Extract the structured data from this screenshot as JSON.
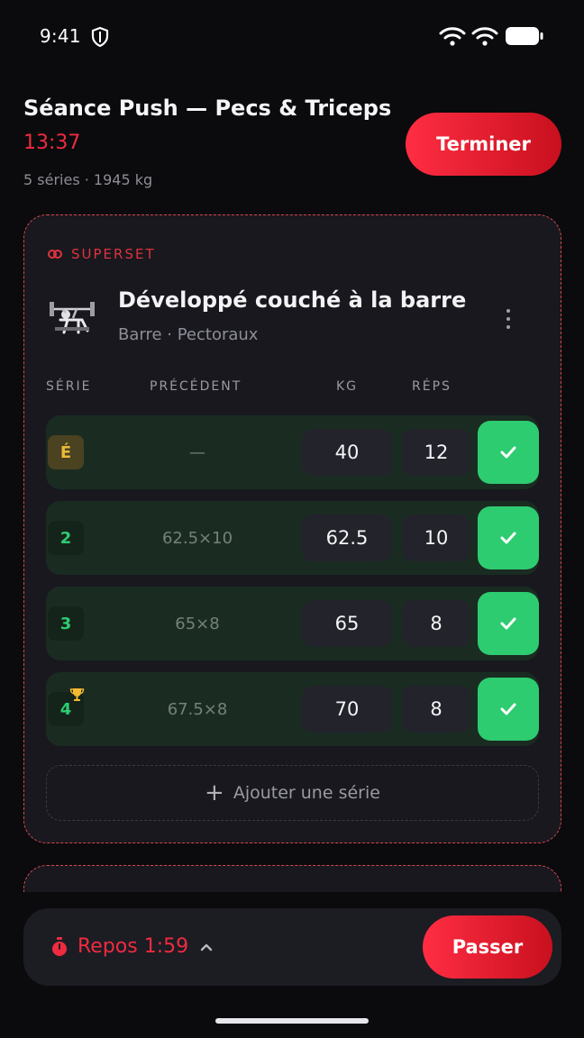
{
  "status_bar": {
    "time": "9:41",
    "icons": [
      "shield-icon",
      "wifi-icon",
      "wifi-icon",
      "battery-icon"
    ]
  },
  "header": {
    "title": "Séance Push — Pecs & Triceps",
    "timer": "13:37",
    "summary": "5 séries · 1945 kg",
    "finish_label": "Terminer"
  },
  "exercise": {
    "group_label": "SUPERSET",
    "name": "Développé couché à la barre",
    "meta": "Barre · Pectoraux",
    "columns": {
      "set": "SÉRIE",
      "previous": "PRÉCÉDENT",
      "kg": "KG",
      "reps": "RÉPS"
    },
    "sets": [
      {
        "label": "É",
        "previous": "—",
        "kg": "40",
        "reps": "12",
        "type": "warmup",
        "pr": false,
        "done": true
      },
      {
        "label": "2",
        "previous": "62.5×10",
        "kg": "62.5",
        "reps": "10",
        "type": "normal",
        "pr": false,
        "done": true
      },
      {
        "label": "3",
        "previous": "65×8",
        "kg": "65",
        "reps": "8",
        "type": "normal",
        "pr": false,
        "done": true
      },
      {
        "label": "4",
        "previous": "67.5×8",
        "kg": "70",
        "reps": "8",
        "type": "normal",
        "pr": true,
        "done": true
      }
    ],
    "add_set_label": "Ajouter une série"
  },
  "rest": {
    "label": "Repos 1:59",
    "skip_label": "Passer"
  },
  "colors": {
    "accent": "#ef2b3f",
    "success": "#2ecc71",
    "warmup": "#e8b93a",
    "background": "#0b0b0d",
    "card": "#18181e"
  }
}
